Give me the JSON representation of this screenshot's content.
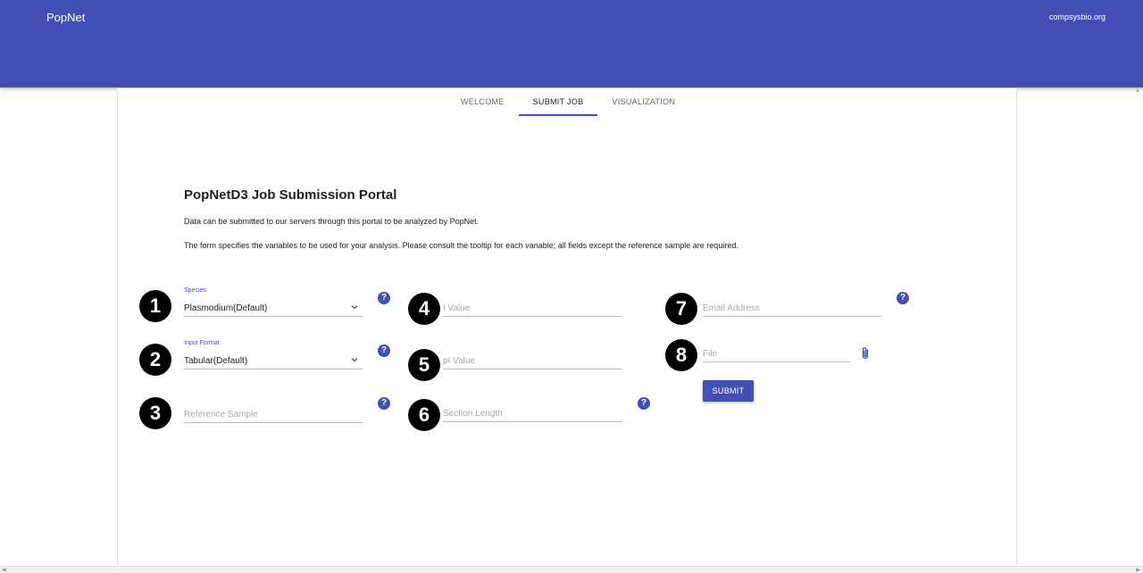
{
  "header": {
    "brand": "PopNet",
    "site_link": "compsysbio.org",
    "accent": "#444fb6"
  },
  "tabs": [
    {
      "label": "WELCOME",
      "active": false
    },
    {
      "label": "SUBMIT JOB",
      "active": true
    },
    {
      "label": "VISUALIZATION",
      "active": false
    }
  ],
  "main": {
    "title": "PopNetD3 Job Submission Portal",
    "desc1": "Data can be submitted to our servers through this portal to be analyzed by PopNet.",
    "desc2": "The form specifies the variables to be used for your analysis. Please consult the tooltip for each variable; all fields except the reference sample are required."
  },
  "markers": [
    "1",
    "2",
    "3",
    "4",
    "5",
    "6",
    "7",
    "8"
  ],
  "form": {
    "species": {
      "label": "Species",
      "value": "Plasmodium(Default)"
    },
    "input_format": {
      "label": "Input Format",
      "value": "Tabular(Default)"
    },
    "reference_sample": {
      "placeholder": "Reference Sample"
    },
    "i_value": {
      "placeholder": "I Value"
    },
    "pi_value": {
      "placeholder": "pI Value"
    },
    "section_length": {
      "placeholder": "Section Length"
    },
    "email": {
      "placeholder": "Email Address"
    },
    "file": {
      "placeholder": "File"
    },
    "submit_label": "SUBMIT",
    "help_glyph": "?"
  },
  "icons": {
    "help": "help-circle-icon",
    "dropdown": "chevron-down-icon",
    "attach": "paperclip-icon"
  }
}
